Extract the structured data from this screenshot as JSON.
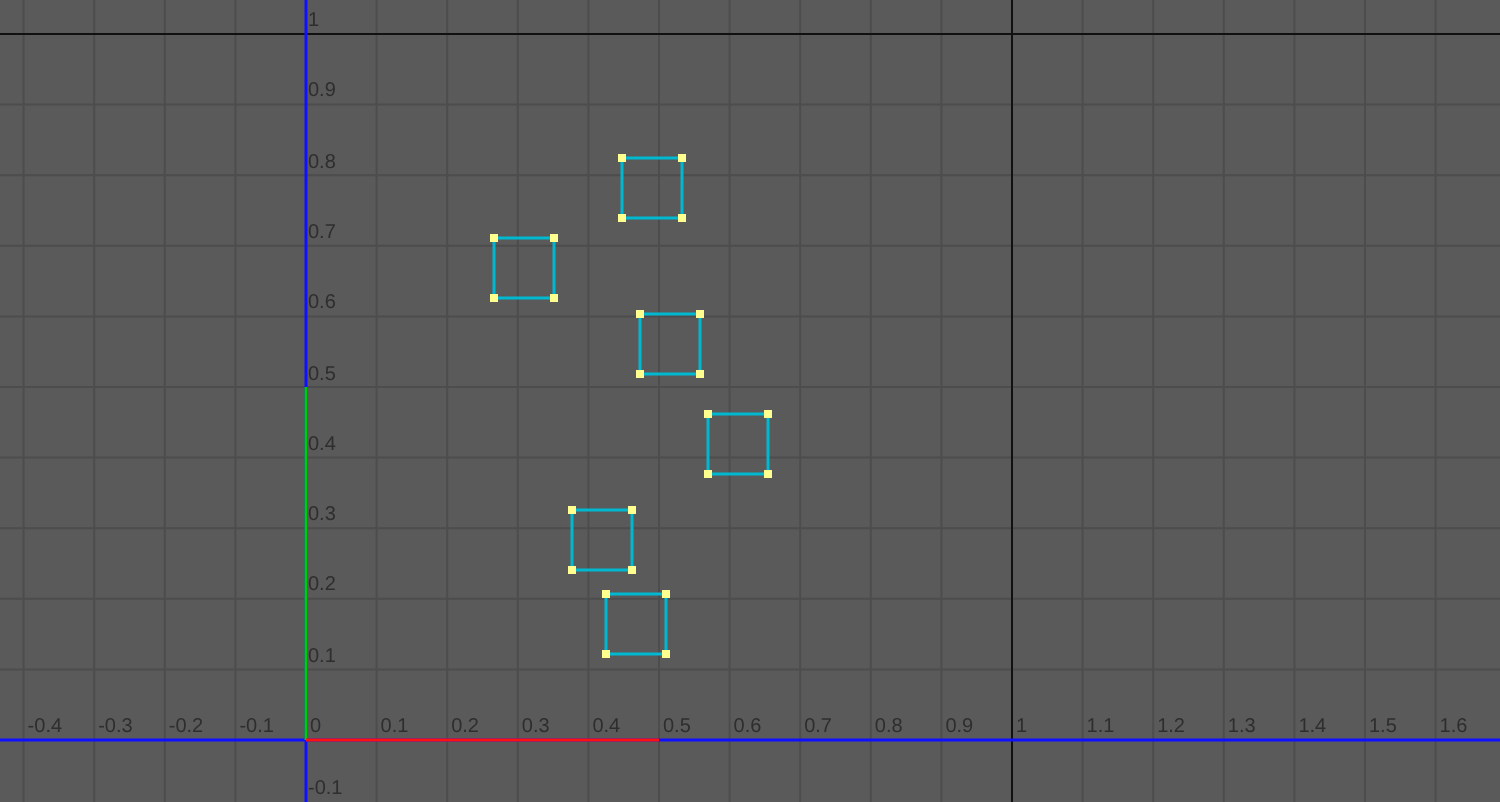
{
  "u_labels": [
    "-0.4",
    "-0.3",
    "-0.2",
    "-0.1",
    "0",
    "0.1",
    "0.2",
    "0.3",
    "0.4",
    "0.5",
    "0.6",
    "0.7",
    "0.8",
    "0.9",
    "1",
    "1.1",
    "1.2",
    "1.3",
    "1.4",
    "1.5",
    "1.6"
  ],
  "v_labels": [
    "1",
    "0.9",
    "0.8",
    "0.7",
    "0.6",
    "0.5",
    "0.4",
    "0.3",
    "0.2",
    "0.1",
    "-0.1"
  ]
}
